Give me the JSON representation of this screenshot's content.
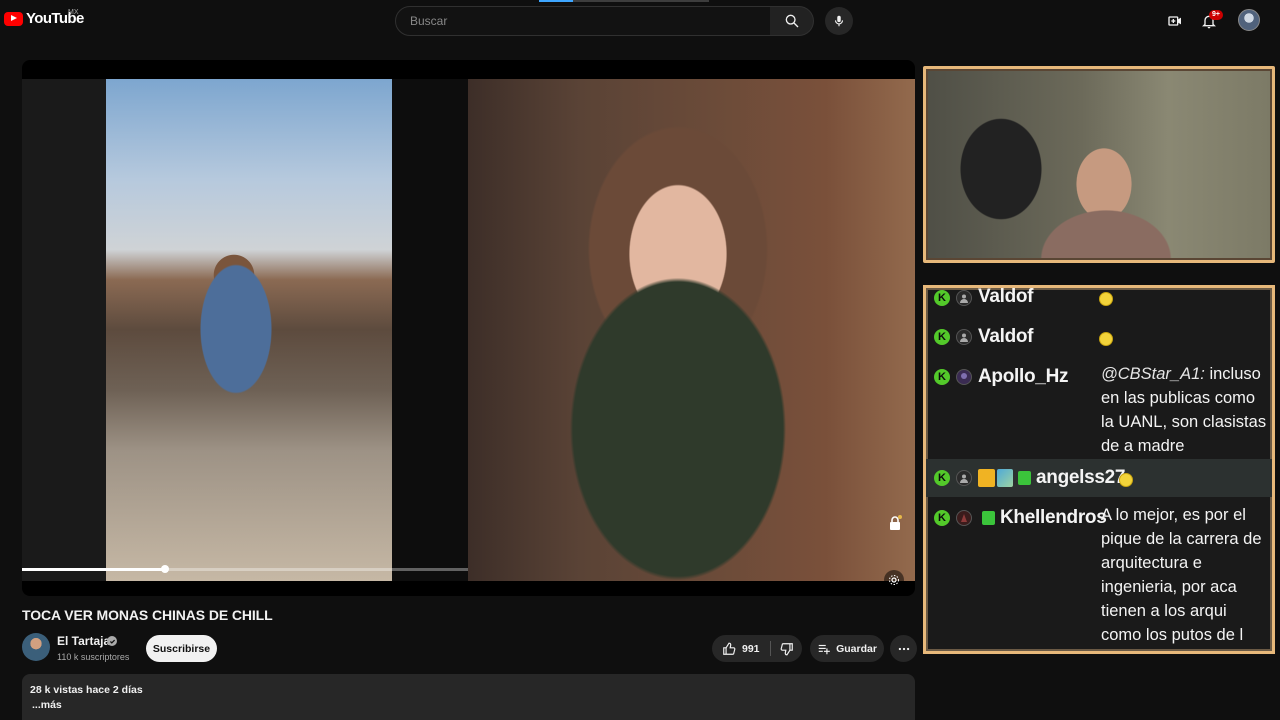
{
  "header": {
    "logo_text": "YouTube",
    "region": "MX",
    "search_placeholder": "Buscar",
    "notifications_count": "9+"
  },
  "player": {
    "progress_fraction": 0.32
  },
  "chat": {
    "messages": [
      {
        "user": "Valdof",
        "text": ""
      },
      {
        "user": "Valdof",
        "text": ""
      },
      {
        "user": "Apollo_Hz",
        "mention": "@CBStar_A1:",
        "text": "incluso en las publicas como la UANL, son clasistas de a madre"
      },
      {
        "user": "angelss27",
        "text": ""
      },
      {
        "user": "Khellendros",
        "text": "A lo mejor, es por el pique de la carrera de arquitectura e ingenieria, por aca tienen a los arqui como los putos de l carrera"
      }
    ]
  },
  "video": {
    "title": "TOCA VER MONAS CHINAS DE CHILL",
    "channel_name": "El Tartaja",
    "subscribers": "110 k suscriptores",
    "subscribe_label": "Suscribirse",
    "likes": "991",
    "save_label": "Guardar",
    "views_and_date": "28 k vistas  hace 2 días",
    "more_label": "...más"
  },
  "colors": {
    "brand_red": "#ff0000",
    "chat_badge_green": "#53c92a",
    "overlay_frame": "#e7b87a"
  },
  "icons": [
    "youtube-logo-icon",
    "search-icon",
    "mic-icon",
    "create-video-icon",
    "bell-icon",
    "like-icon",
    "dislike-icon",
    "save-playlist-icon",
    "more-icon",
    "verified-icon",
    "lock-icon",
    "settings-icon"
  ]
}
